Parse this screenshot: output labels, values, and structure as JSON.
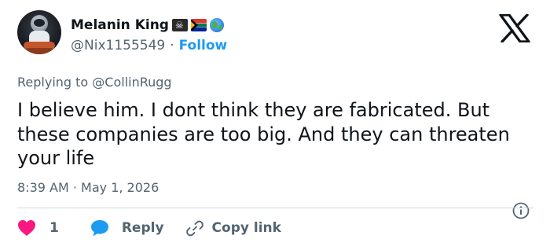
{
  "author": {
    "display_name": "Melanin King",
    "name_emojis": [
      "pirate-flag",
      "south-africa-flag",
      "globe"
    ],
    "handle": "@Nix1155549",
    "separator": "·",
    "follow_label": "Follow"
  },
  "reply": {
    "prefix": "Replying to",
    "mention": "@CollinRugg"
  },
  "tweet": {
    "text": "I believe him. I dont think they are fabricated. But these companies are too big. And they can threaten your life",
    "timestamp": "8:39 AM · May 1, 2026"
  },
  "actions": {
    "like_count": "1",
    "reply_label": "Reply",
    "copy_link_label": "Copy link"
  },
  "colors": {
    "accent": "#1d9bf0",
    "heart": "#f91880",
    "reply_bubble": "#1d9bf0",
    "secondary_text": "#536471"
  },
  "icons": [
    "x-logo",
    "info-icon",
    "heart-icon",
    "reply-bubble-icon",
    "link-icon"
  ]
}
